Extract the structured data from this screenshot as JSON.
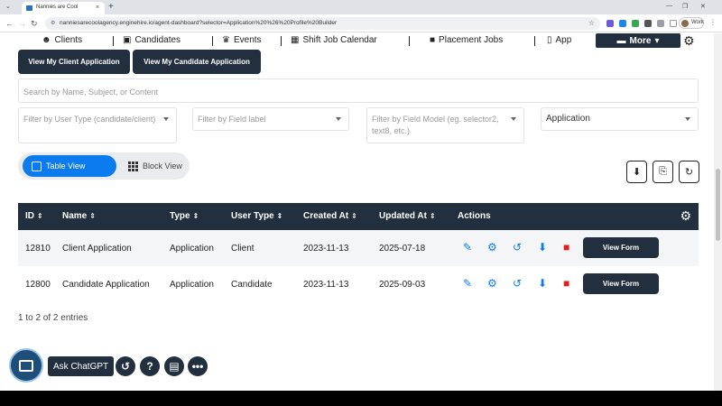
{
  "browser": {
    "tab_title": "Nannies are Cool",
    "tab_close": "×",
    "new_tab": "+",
    "url": "nanniesarecoolagency.enginehire.io/agent-dashboard?selector=Application%20%26%20Profile%20Builder",
    "profile_label": "Work"
  },
  "nav": {
    "items": [
      {
        "label": "Clients",
        "icon": "user-circle-icon"
      },
      {
        "label": "Candidates",
        "icon": "briefcase-user-icon"
      },
      {
        "label": "Events",
        "icon": "trophy-icon"
      },
      {
        "label": "Shift Job Calendar",
        "icon": "calendar-icon"
      },
      {
        "label": "Placement Jobs",
        "icon": "briefcase-icon"
      },
      {
        "label": "App",
        "icon": "mobile-icon"
      }
    ],
    "more_label": "More"
  },
  "buttons": {
    "client_app": "View My Client Application",
    "candidate_app": "View My Candidate Application"
  },
  "search": {
    "placeholder": "Search by Name, Subject, or Content"
  },
  "filters": {
    "user_type": "Filter by User Type (candidate/client)",
    "field_label": "Filter by Field label",
    "field_model": "Filter by Field Model (eg. selector2, text8, etc.)",
    "selected": "Application"
  },
  "view_toggle": {
    "table": "Table View",
    "block": "Block View"
  },
  "table": {
    "headers": [
      "ID",
      "Name",
      "Type",
      "User Type",
      "Created At",
      "Updated At",
      "Actions"
    ],
    "rows": [
      {
        "id": "12810",
        "name": "Client Application",
        "type": "Application",
        "user_type": "Client",
        "created": "2023-11-13",
        "updated": "2025-07-18",
        "action": "View Form"
      },
      {
        "id": "12800",
        "name": "Candidate Application",
        "type": "Application",
        "user_type": "Candidate",
        "created": "2023-11-13",
        "updated": "2025-09-03",
        "action": "View Form"
      }
    ],
    "entries": "1 to 2 of 2 entries"
  },
  "assistant": {
    "ask_label": "Ask ChatGPT"
  },
  "colors": {
    "dark": "#222f3e",
    "accent": "#0d7bf0",
    "delete": "#e0201b"
  }
}
